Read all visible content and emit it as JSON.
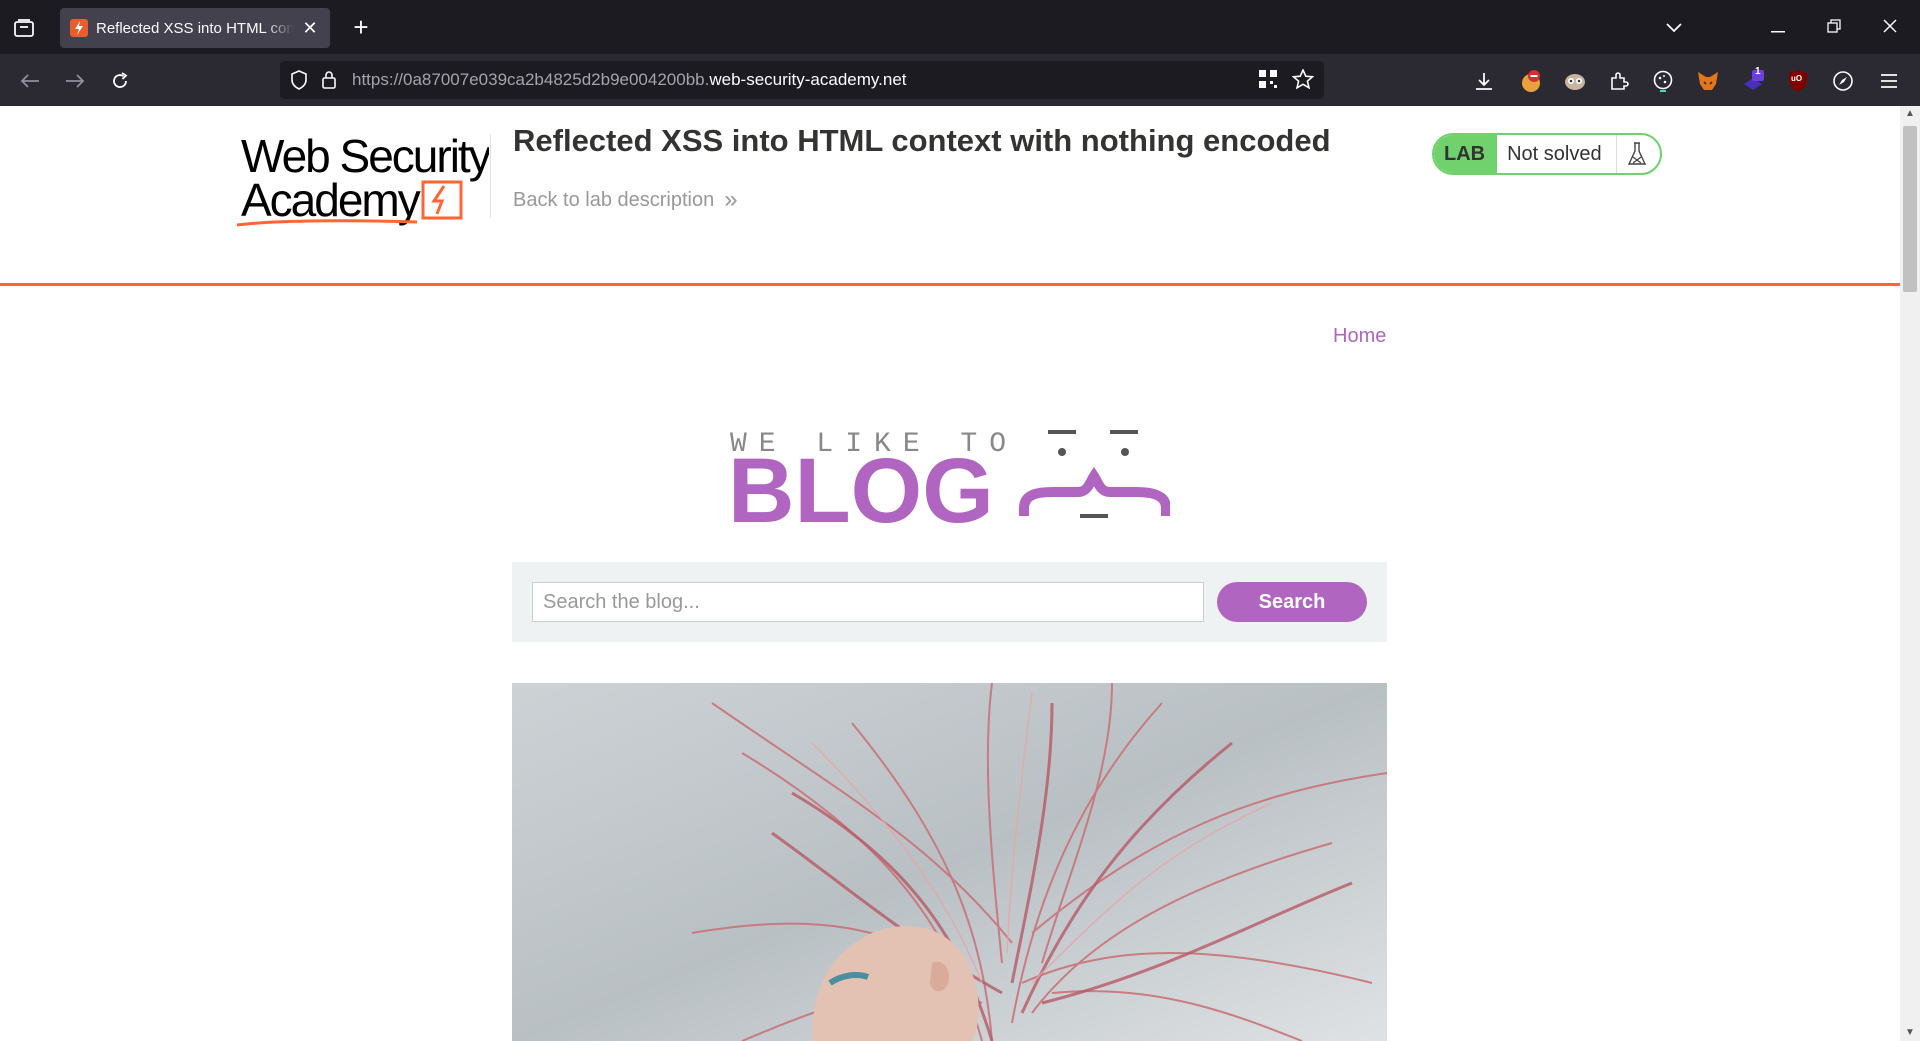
{
  "browser": {
    "tab": {
      "title": "Reflected XSS into HTML context with nothing encoded",
      "close": "✕"
    },
    "new_tab": "+",
    "window_controls": {
      "list_all_tabs": "⌄",
      "minimize": "—",
      "restore": "❐",
      "close": "✕"
    },
    "url": {
      "prefix": "https://0a87007e039ca2b4825d2b9e004200bb.",
      "domain": "web-security-academy.net"
    },
    "extensions": [
      "download-icon",
      "ublock-stop-icon",
      "privacy-badger-icon",
      "extensions-icon",
      "cookie-icon",
      "metamask-icon",
      "notification-extension-icon",
      "ublock-origin-icon",
      "compass-icon",
      "menu-icon"
    ],
    "extension_badge": "1",
    "ublock_label": "uO"
  },
  "lab": {
    "logo_line1": "Web Security",
    "logo_line2": "Academy",
    "title": "Reflected XSS into HTML context with nothing encoded",
    "back_link": "Back to lab description",
    "back_chevrons": "»",
    "badge": "LAB",
    "status": "Not solved",
    "accent_color": "#ff6633",
    "status_color": "#70d16d"
  },
  "blog": {
    "nav_home": "Home",
    "banner_small": "WE LIKE TO",
    "banner_big": "BLOG",
    "search_placeholder": "Search the blog...",
    "search_button": "Search",
    "brand_color": "#b066c0"
  }
}
